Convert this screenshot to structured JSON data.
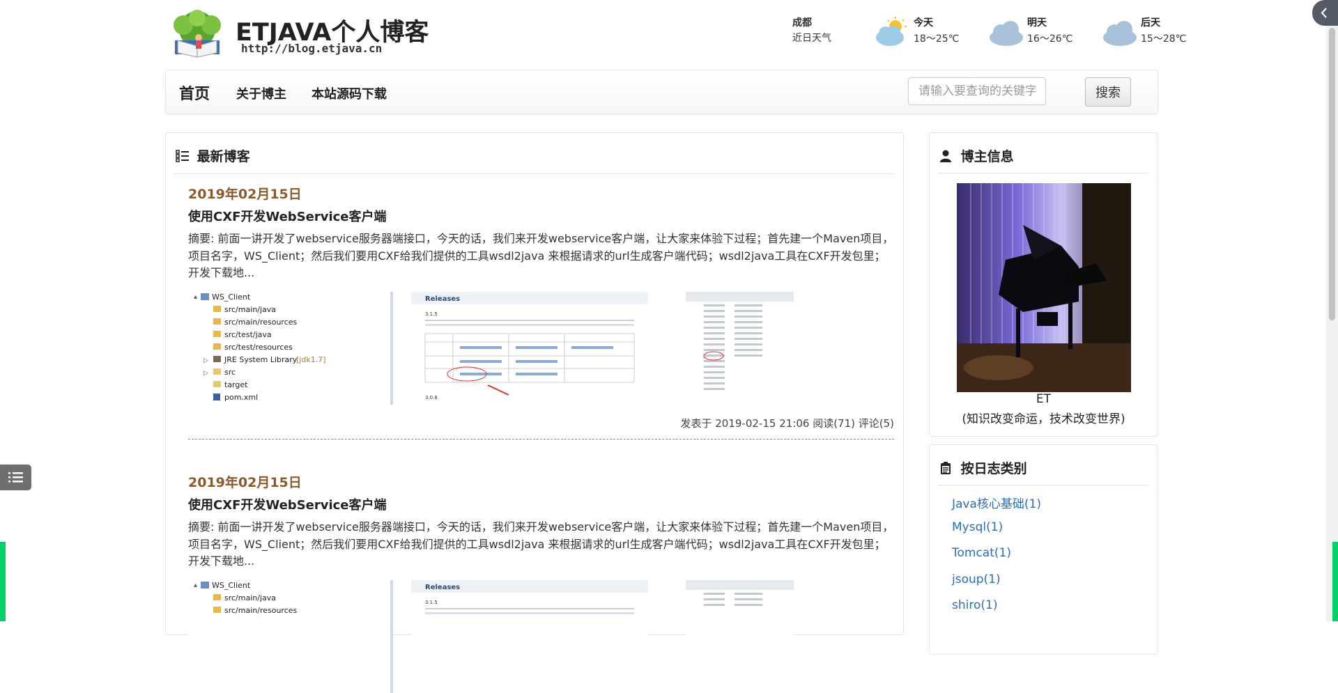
{
  "site": {
    "title": "ETJAVA个人博客",
    "url_text": "http://blog.etjava.cn"
  },
  "weather": {
    "city": "成都",
    "subtitle": "近日天气",
    "days": [
      {
        "label": "今天",
        "temp": "18～25℃",
        "icon": "partly-sunny-cloud-icon"
      },
      {
        "label": "明天",
        "temp": "16～26℃",
        "icon": "cloud-icon"
      },
      {
        "label": "后天",
        "temp": "15～28℃",
        "icon": "cloud-icon"
      }
    ]
  },
  "nav": {
    "home": "首页",
    "about": "关于博主",
    "download": "本站源码下载",
    "search_placeholder": "请输入要查询的关键字...",
    "search_button": "搜索"
  },
  "main": {
    "heading": "最新博客",
    "posts": [
      {
        "date": "2019年02月15日",
        "title": "使用CXF开发WebService客户端",
        "summary": "摘要: 前面一讲开发了webservice服务器端接口，今天的话，我们来开发webservice客户端，让大家来体验下过程；首先建一个Maven项目，项目名字，WS_Client；然后我们要用CXF给我们提供的工具wsdl2java 来根据请求的url生成客户端代码；wsdl2java工具在CXF开发包里；开发下载地...",
        "meta": "发表于 2019-02-15 21:06 阅读(71) 评论(5)",
        "tree": [
          "WS_Client",
          "src/main/java",
          "src/main/resources",
          "src/test/java",
          "src/test/resources",
          "JRE System Library",
          "[jdk1.7]",
          "src",
          "target",
          "pom.xml"
        ],
        "releases_title": "Releases",
        "release_versions": [
          "3.1.5",
          "3.0.8"
        ]
      },
      {
        "date": "2019年02月15日",
        "title": "使用CXF开发WebService客户端",
        "summary": "摘要: 前面一讲开发了webservice服务器端接口，今天的话，我们来开发webservice客户端，让大家来体验下过程；首先建一个Maven项目，项目名字，WS_Client；然后我们要用CXF给我们提供的工具wsdl2java 来根据请求的url生成客户端代码；wsdl2java工具在CXF开发包里；开发下载地...",
        "tree": [
          "WS_Client",
          "src/main/java",
          "src/main/resources"
        ],
        "releases_title": "Releases",
        "release_versions": [
          "3.1.5"
        ]
      }
    ]
  },
  "sidebar": {
    "owner_heading": "博主信息",
    "owner_name": "ET",
    "owner_motto": "(知识改变命运，技术改变世界)",
    "category_heading": "按日志类别",
    "categories": [
      "Java核心基础(1)",
      "Mysql(1)",
      "Tomcat(1)",
      "jsoup(1)",
      "shiro(1)"
    ]
  },
  "colors": {
    "date": "#8b5a2b",
    "link": "#2a6db8",
    "accent_green": "#00d26a"
  }
}
